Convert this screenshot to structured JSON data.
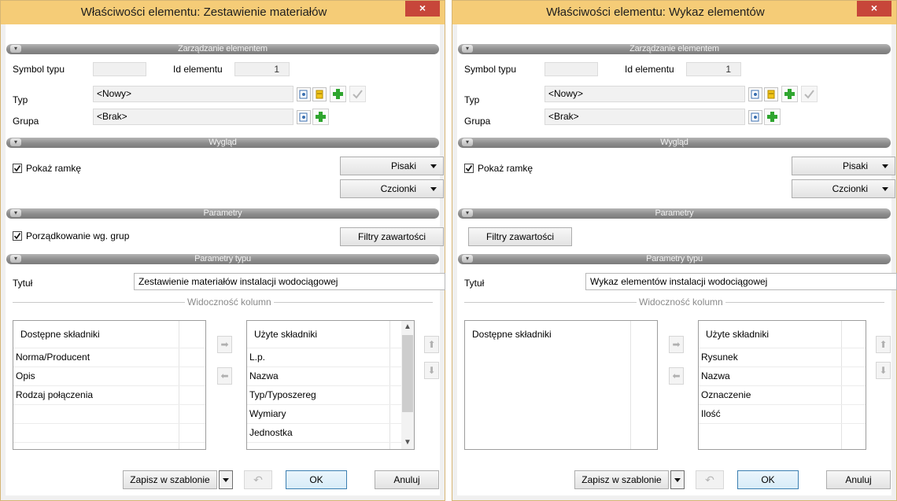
{
  "left": {
    "title": "Właściwości elementu: Zestawienie materiałów",
    "close_label": "×",
    "sections": {
      "management": "Zarządzanie elementem",
      "appearance": "Wygląd",
      "parameters": "Parametry",
      "type_parameters": "Parametry typu"
    },
    "symbol_label": "Symbol typu",
    "symbol_value": "",
    "id_label": "Id elementu",
    "id_value": "1",
    "type_label": "Typ",
    "type_value": "<Nowy>",
    "group_label": "Grupa",
    "group_value": "<Brak>",
    "show_frame_label": "Pokaż ramkę",
    "show_frame_checked": true,
    "pens_label": "Pisaki",
    "fonts_label": "Czcionki",
    "group_order_label": "Porządkowanie wg. grup",
    "group_order_checked": true,
    "filters_label": "Filtry zawartości",
    "title_label": "Tytuł",
    "title_value": "Zestawienie materiałów instalacji wodociągowej",
    "columns_visibility": "Widoczność kolumn",
    "available_header": "Dostępne składniki",
    "available_items": [
      "Norma/Producent",
      "Opis",
      "Rodzaj połączenia"
    ],
    "used_header": "Użyte składniki",
    "used_items": [
      "L.p.",
      "Nazwa",
      "Typ/Typoszereg",
      "Wymiary",
      "Jednostka"
    ],
    "save_template_label": "Zapisz w szablonie",
    "ok_label": "OK",
    "cancel_label": "Anuluj"
  },
  "right": {
    "title": "Właściwości elementu: Wykaz elementów",
    "close_label": "×",
    "sections": {
      "management": "Zarządzanie elementem",
      "appearance": "Wygląd",
      "parameters": "Parametry",
      "type_parameters": "Parametry typu"
    },
    "symbol_label": "Symbol typu",
    "symbol_value": "",
    "id_label": "Id elementu",
    "id_value": "1",
    "type_label": "Typ",
    "type_value": "<Nowy>",
    "group_label": "Grupa",
    "group_value": "<Brak>",
    "show_frame_label": "Pokaż ramkę",
    "show_frame_checked": true,
    "pens_label": "Pisaki",
    "fonts_label": "Czcionki",
    "filters_label": "Filtry zawartości",
    "title_label": "Tytuł",
    "title_value": "Wykaz elementów instalacji wodociągowej",
    "columns_visibility": "Widoczność kolumn",
    "available_header": "Dostępne składniki",
    "available_items": [],
    "used_header": "Użyte składniki",
    "used_items": [
      "Rysunek",
      "Nazwa",
      "Oznaczenie",
      "Ilość"
    ],
    "save_template_label": "Zapisz w szablonie",
    "ok_label": "OK",
    "cancel_label": "Anuluj"
  },
  "icons": {
    "pick_type": "pick-type-icon",
    "edit_type": "edit-type-icon",
    "add": "plus-icon",
    "confirm": "checkmark-icon",
    "move_right": "arrow-right-icon",
    "move_left": "arrow-left-icon",
    "move_up": "arrow-up-icon",
    "move_down": "arrow-down-icon",
    "undo": "undo-icon"
  },
  "colors": {
    "titlebar": "#f5cc77",
    "close_button": "#c7463a",
    "section_header": "#8c8c8c",
    "plus_green": "#2fa52f",
    "ok_border": "#3c7fb1"
  }
}
